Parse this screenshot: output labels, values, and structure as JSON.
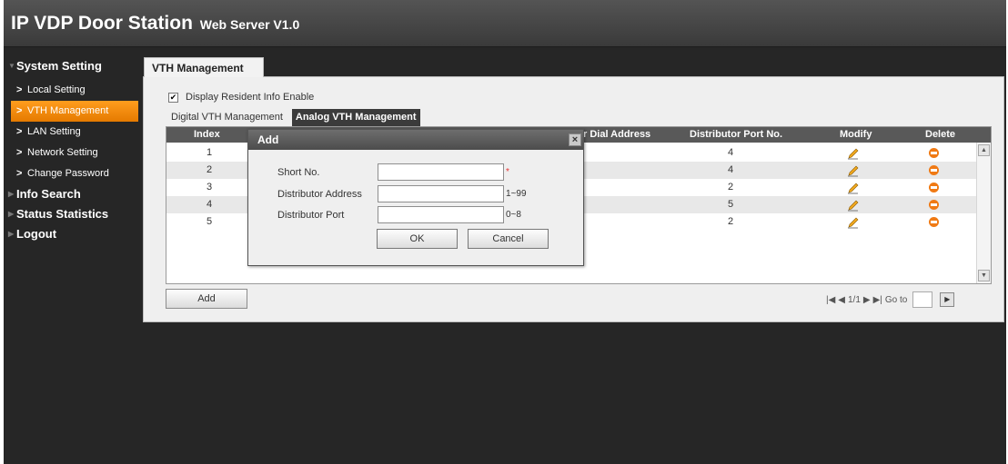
{
  "app": {
    "title": "IP VDP Door Station",
    "subtitle": "Web Server V1.0"
  },
  "sidebar": {
    "system_setting": "System Setting",
    "items": [
      {
        "label": "Local Setting"
      },
      {
        "label": "VTH Management"
      },
      {
        "label": "LAN Setting"
      },
      {
        "label": "Network Setting"
      },
      {
        "label": "Change Password"
      }
    ],
    "info_search": "Info Search",
    "status_statistics": "Status Statistics",
    "logout": "Logout"
  },
  "main": {
    "tab": "VTH Management",
    "display_resident_label": "Display Resident Info Enable",
    "display_resident_checked": true,
    "subtabs": [
      "Digital VTH Management",
      "Analog VTH Management"
    ],
    "table": {
      "headers": {
        "index": "Index",
        "dial": "r Dial Address",
        "port": "Distributor Port No.",
        "modify": "Modify",
        "delete": "Delete"
      },
      "rows": [
        {
          "index": "1",
          "port": "4"
        },
        {
          "index": "2",
          "port": "4"
        },
        {
          "index": "3",
          "port": "2"
        },
        {
          "index": "4",
          "port": "5"
        },
        {
          "index": "5",
          "port": "2"
        }
      ]
    },
    "add_label": "Add",
    "pager": {
      "page_info": "1/1",
      "goto_label": "Go to"
    }
  },
  "dialog": {
    "title": "Add",
    "close_glyph": "×",
    "fields": [
      {
        "label": "Short No.",
        "hint": "*"
      },
      {
        "label": "Distributor Address",
        "hint": "1~99"
      },
      {
        "label": "Distributor Port",
        "hint": "0~8"
      }
    ],
    "ok_label": "OK",
    "cancel_label": "Cancel"
  }
}
